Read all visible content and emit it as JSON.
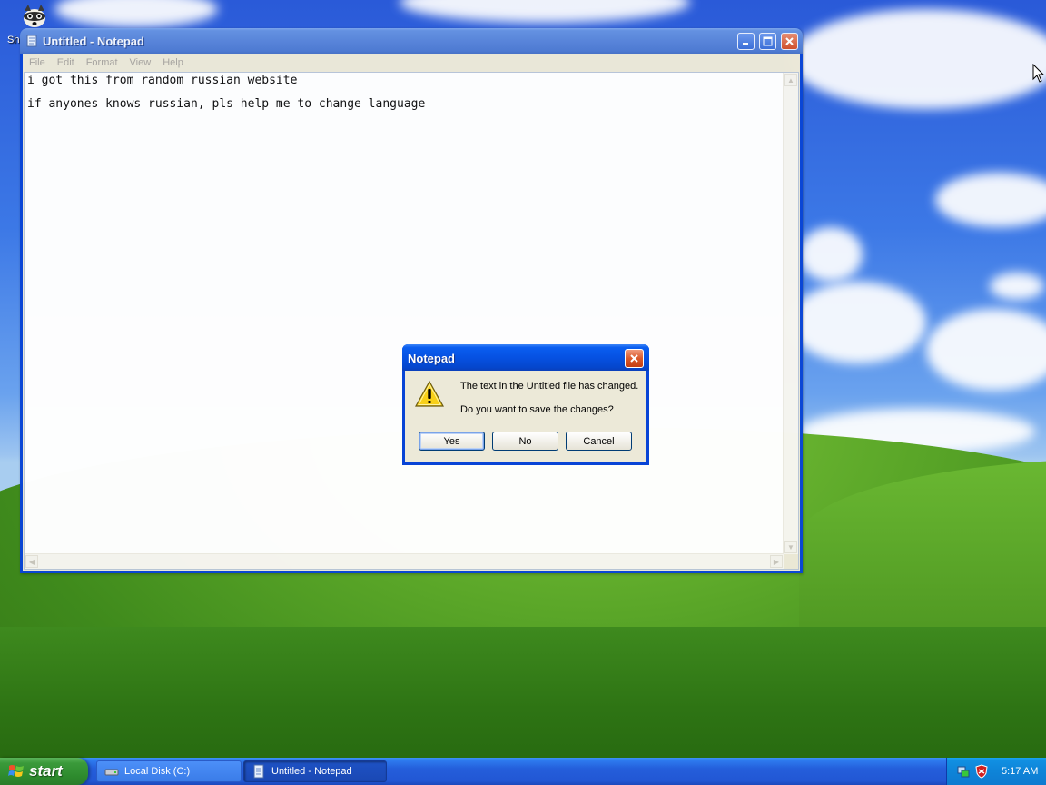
{
  "desktop": {
    "icon_label": "Sh"
  },
  "notepad": {
    "title": "Untitled - Notepad",
    "menu": [
      "File",
      "Edit",
      "Format",
      "View",
      "Help"
    ],
    "lines": [
      "i got this from random russian website",
      "if anyones knows russian, pls help me to change language"
    ]
  },
  "dialog": {
    "title": "Notepad",
    "message_line1": "The text in the Untitled file has changed.",
    "message_line2": "Do you want to save the changes?",
    "buttons": {
      "yes": "Yes",
      "no": "No",
      "cancel": "Cancel"
    }
  },
  "taskbar": {
    "start_label": "start",
    "tasks": [
      {
        "label": "Local Disk (C:)",
        "icon": "drive-icon",
        "active": false
      },
      {
        "label": "Untitled - Notepad",
        "icon": "notepad-icon",
        "active": true
      }
    ],
    "clock": "5:17 AM",
    "tray_icons": [
      "network-icon",
      "security-shield-icon"
    ]
  },
  "colors": {
    "xp_title_blue": "#0651e2",
    "inactive_title": "#5a86da",
    "start_green": "#3a9a3a",
    "face": "#ece9d8"
  }
}
